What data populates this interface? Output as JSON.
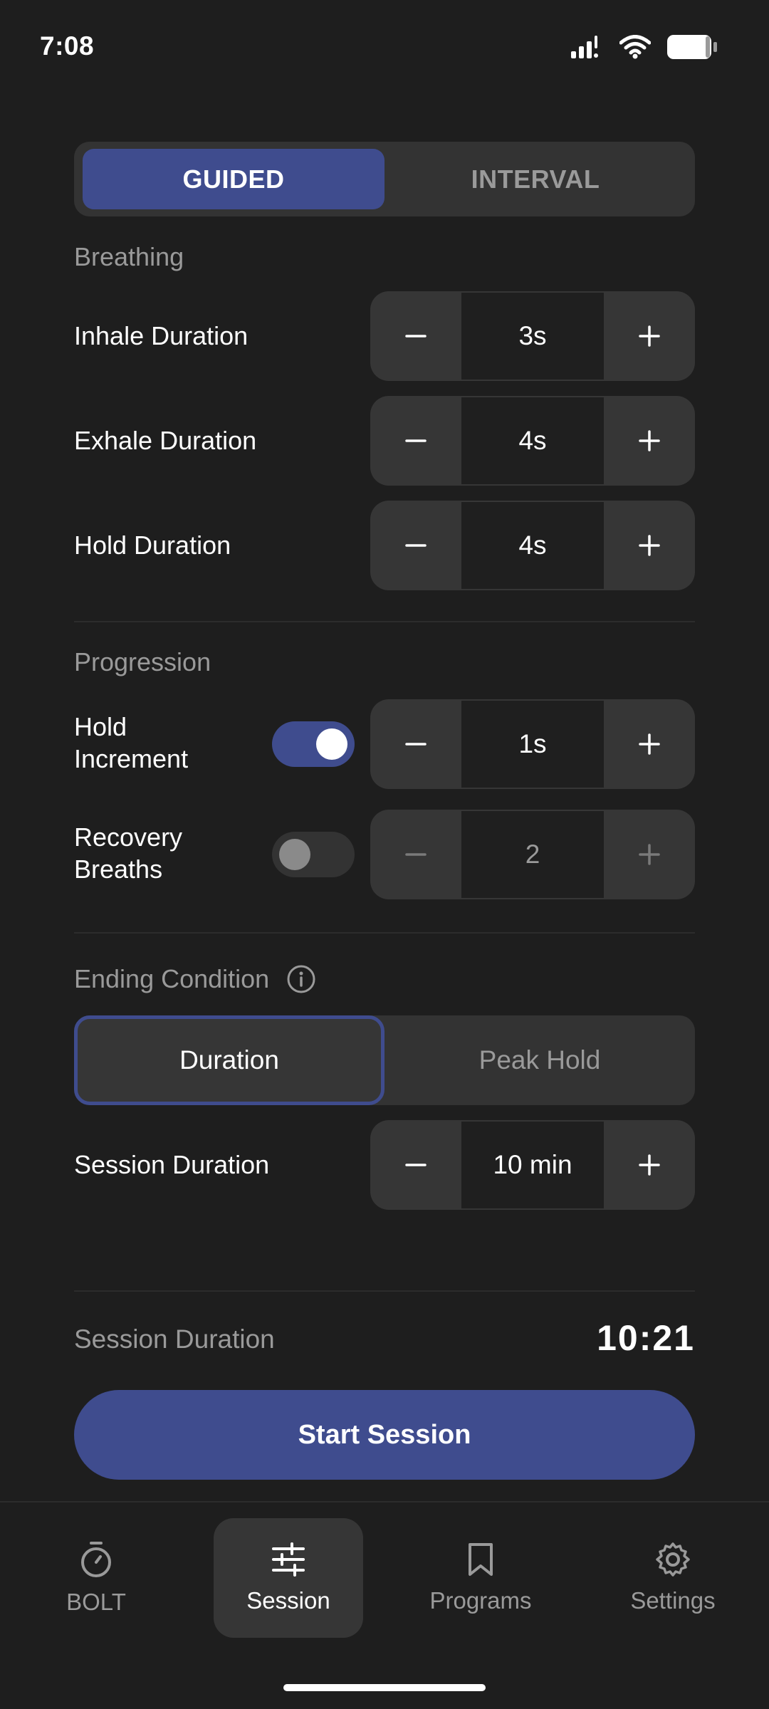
{
  "status_bar": {
    "time": "7:08"
  },
  "mode": {
    "options": [
      "GUIDED",
      "INTERVAL"
    ],
    "selected": "GUIDED"
  },
  "breathing": {
    "section_label": "Breathing",
    "inhale": {
      "label": "Inhale Duration",
      "value": "3s"
    },
    "exhale": {
      "label": "Exhale Duration",
      "value": "4s"
    },
    "hold": {
      "label": "Hold Duration",
      "value": "4s"
    }
  },
  "progression": {
    "section_label": "Progression",
    "hold_increment": {
      "label_line1": "Hold",
      "label_line2": "Increment",
      "value": "1s",
      "enabled": true
    },
    "recovery_breaths": {
      "label_line1": "Recovery",
      "label_line2": "Breaths",
      "value": "2",
      "enabled": false
    }
  },
  "ending": {
    "section_label": "Ending Condition",
    "options": [
      "Duration",
      "Peak Hold"
    ],
    "selected": "Duration",
    "session_duration": {
      "label": "Session Duration",
      "value": "10 min"
    }
  },
  "summary": {
    "label": "Session Duration",
    "value": "10:21"
  },
  "start_button": "Start Session",
  "nav": {
    "items": [
      {
        "label": "BOLT",
        "icon": "stopwatch-icon"
      },
      {
        "label": "Session",
        "icon": "sliders-icon"
      },
      {
        "label": "Programs",
        "icon": "bookmark-icon"
      },
      {
        "label": "Settings",
        "icon": "gear-icon"
      }
    ],
    "selected": "Session"
  },
  "colors": {
    "accent": "#3f4c8e",
    "background": "#1e1e1e",
    "surface": "#363636",
    "muted_text": "#9a9a9a"
  }
}
